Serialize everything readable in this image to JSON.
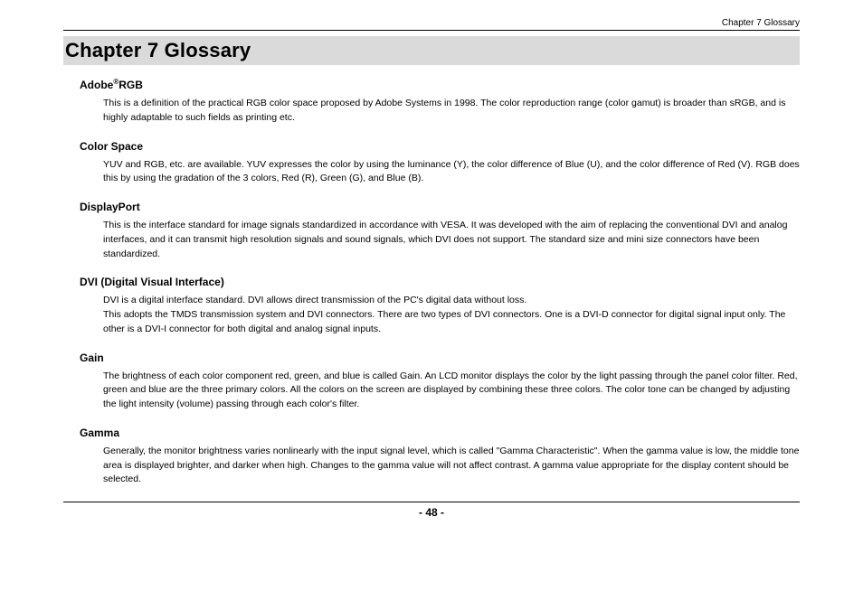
{
  "header": {
    "breadcrumb": "Chapter 7 Glossary"
  },
  "title": "Chapter 7    Glossary",
  "entries": [
    {
      "term_prefix": "Adobe",
      "term_sup": "®",
      "term_suffix": "RGB",
      "definition": "This is a definition of the practical RGB color space proposed by Adobe Systems in 1998. The color reproduction range (color gamut) is broader than sRGB, and is highly adaptable to such fields as printing etc."
    },
    {
      "term": "Color Space",
      "definition": "YUV and RGB, etc. are available. YUV expresses the color by using the luminance (Y), the color difference of Blue (U), and the color difference of Red (V). RGB does this by using the gradation of the 3 colors, Red (R), Green (G), and Blue (B)."
    },
    {
      "term": "DisplayPort",
      "definition": "This is the interface standard for image signals standardized in accordance with VESA. It was developed with the aim of replacing the conventional DVI and analog interfaces, and it can transmit high resolution signals and sound signals, which DVI does not support. The standard size and mini size connectors have been standardized."
    },
    {
      "term": "DVI (Digital Visual Interface)",
      "definition": "DVI is a digital interface standard. DVI allows direct transmission of the PC's digital data without loss.\nThis adopts the TMDS transmission system and DVI connectors. There are two types of DVI connectors. One is a DVI-D connector for digital signal input only. The other is a DVI-I connector for both digital and analog signal inputs."
    },
    {
      "term": "Gain",
      "definition": "The brightness of each color component red, green, and blue is called Gain. An LCD monitor displays the color by the light passing through the panel color filter. Red, green and blue are the three primary colors. All the colors on the screen are displayed by combining these three colors. The color tone can be changed by adjusting the light intensity (volume) passing through each color's filter."
    },
    {
      "term": "Gamma",
      "definition": "Generally, the monitor brightness varies nonlinearly with the input signal level, which is called \"Gamma Characteristic\". When the gamma value is low, the middle tone area is displayed brighter, and darker when high. Changes to the gamma value will not affect contrast. A gamma value appropriate for the display content should be selected."
    }
  ],
  "page_number": "- 48 -"
}
